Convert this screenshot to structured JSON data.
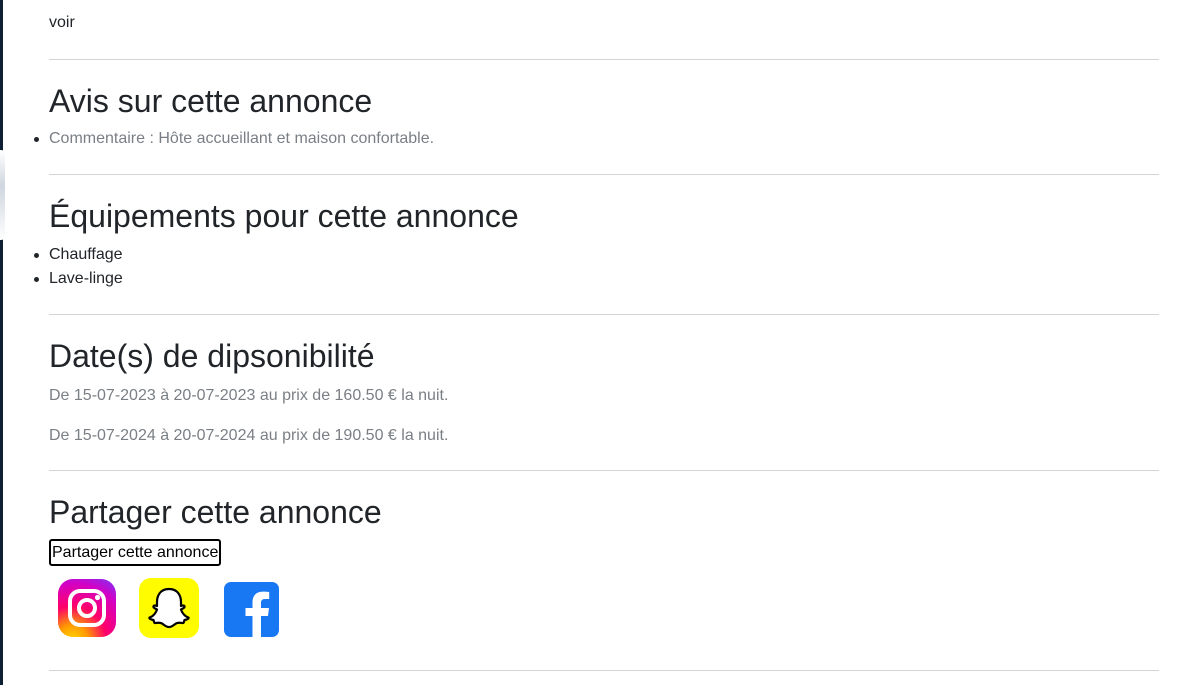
{
  "top_link": "voir",
  "reviews": {
    "title": "Avis sur cette annonce",
    "items": [
      "Commentaire : Hôte accueillant et maison confortable."
    ]
  },
  "amenities": {
    "title": "Équipements pour cette annonce",
    "items": [
      "Chauffage",
      "Lave-linge"
    ]
  },
  "availability": {
    "title": "Date(s) de dipsonibilité",
    "lines": [
      "De 15-07-2023 à 20-07-2023 au prix de 160.50 € la nuit.",
      "De 15-07-2024 à 20-07-2024 au prix de 190.50 € la nuit."
    ]
  },
  "share": {
    "title": "Partager cette annonce",
    "button_label": "Partager cette annonce",
    "icons": [
      "instagram-icon",
      "snapchat-icon",
      "facebook-icon"
    ]
  },
  "colors": {
    "text": "#212529",
    "muted": "#7a7f85",
    "divider": "#d5d5d5",
    "snapchat_yellow": "#FFFC00",
    "facebook_blue": "#1877F2"
  }
}
